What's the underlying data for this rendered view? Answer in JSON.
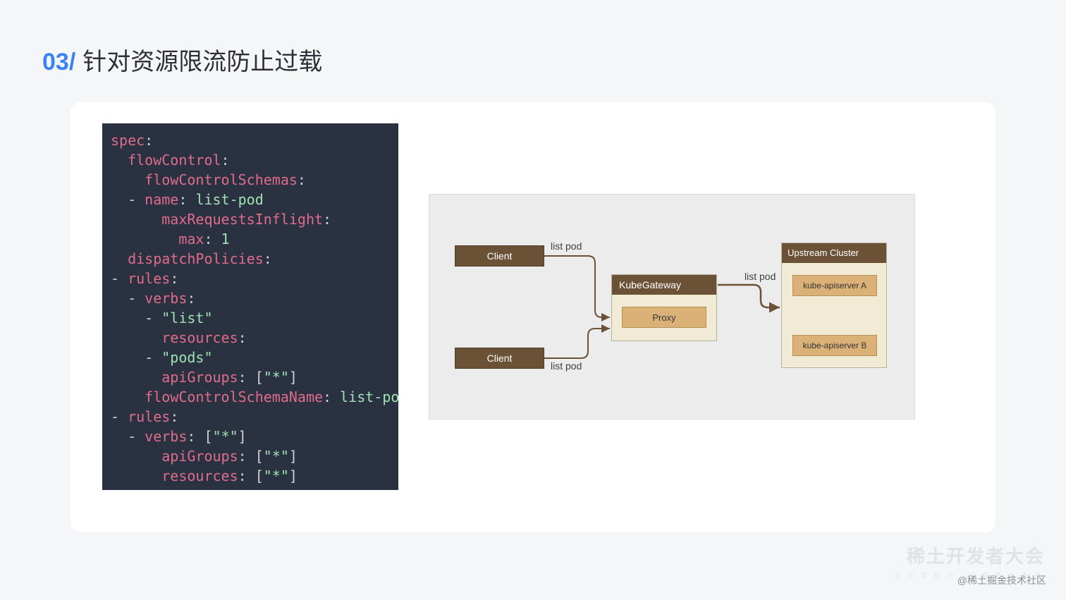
{
  "header": {
    "section_num": "03/",
    "title": "针对资源限流防止过载"
  },
  "code": {
    "lines": [
      {
        "t": "key",
        "indent": 0,
        "text": "spec",
        "suffix": ":"
      },
      {
        "t": "key",
        "indent": 1,
        "text": "flowControl",
        "suffix": ":"
      },
      {
        "t": "key",
        "indent": 2,
        "text": "flowControlSchemas",
        "suffix": ":"
      },
      {
        "t": "kv",
        "indent": 2,
        "dash": true,
        "key": "name",
        "val": "list-pod"
      },
      {
        "t": "key",
        "indent": 3,
        "text": "maxRequestsInflight",
        "suffix": ":"
      },
      {
        "t": "kv",
        "indent": 4,
        "key": "max",
        "val": "1"
      },
      {
        "t": "key",
        "indent": 1,
        "text": "dispatchPolicies",
        "suffix": ":"
      },
      {
        "t": "key",
        "indent": 1,
        "dash": true,
        "text": "rules",
        "suffix": ":"
      },
      {
        "t": "key",
        "indent": 2,
        "dash": true,
        "text": "verbs",
        "suffix": ":"
      },
      {
        "t": "str",
        "indent": 3,
        "dash": true,
        "val": "\"list\""
      },
      {
        "t": "key",
        "indent": 3,
        "text": "resources",
        "suffix": ":"
      },
      {
        "t": "str",
        "indent": 3,
        "dash": true,
        "val": "\"pods\""
      },
      {
        "t": "kvarr",
        "indent": 3,
        "key": "apiGroups",
        "val": "[\"*\"]"
      },
      {
        "t": "kv",
        "indent": 2,
        "key": "flowControlSchemaName",
        "val": "list-pod"
      },
      {
        "t": "key",
        "indent": 1,
        "dash": true,
        "text": "rules",
        "suffix": ":"
      },
      {
        "t": "kvarr",
        "indent": 2,
        "dash": true,
        "key": "verbs",
        "val": "[\"*\"]"
      },
      {
        "t": "kvarr",
        "indent": 3,
        "key": "apiGroups",
        "val": "[\"*\"]"
      },
      {
        "t": "kvarr",
        "indent": 3,
        "key": "resources",
        "val": "[\"*\"]"
      }
    ]
  },
  "diagram": {
    "client1": "Client",
    "client2": "Client",
    "edge1": "list pod",
    "edge2": "list pod",
    "edge3": "list pod",
    "gateway_title": "KubeGateway",
    "proxy": "Proxy",
    "upstream_title": "Upstream Cluster",
    "apiserver_a": "kube-apiserver A",
    "apiserver_b": "kube-apiserver B"
  },
  "footer": {
    "watermark_main": "稀土开发者大会",
    "watermark_sub": "发 光 发 热 力 / 探 索 技 术 未 来",
    "credit": "@稀土掘金技术社区"
  }
}
